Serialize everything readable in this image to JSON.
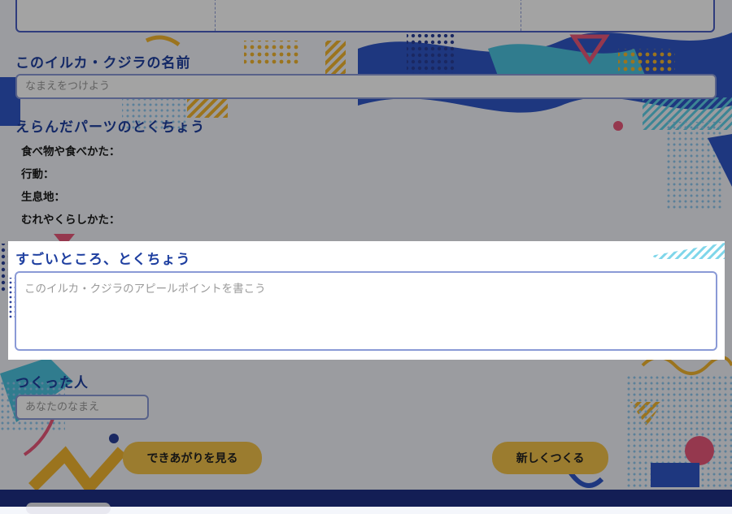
{
  "name_section": {
    "heading": "このイルカ・クジラの名前",
    "placeholder": "なまえをつけよう"
  },
  "features_section": {
    "heading": "えらんだパーツのとくちょう",
    "items": [
      {
        "label": "食べ物や食べかた："
      },
      {
        "label": "行動："
      },
      {
        "label": "生息地："
      },
      {
        "label": "むれやくらしかた："
      }
    ]
  },
  "appeal_section": {
    "heading": "すごいところ、とくちょう",
    "placeholder": "このイルカ・クジラのアピールポイントを書こう"
  },
  "creator_section": {
    "heading": "つくった人",
    "placeholder": "あなたのなまえ"
  },
  "buttons": {
    "preview": "できあがりを見る",
    "new": "新しくつくる"
  },
  "colors": {
    "heading": "#1e3fa0",
    "button": "#f2c24a",
    "footer": "#1f2f86"
  }
}
